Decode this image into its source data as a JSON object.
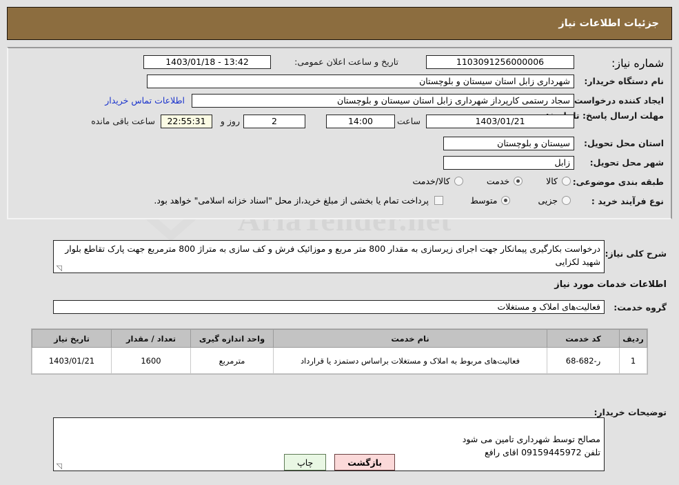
{
  "header": {
    "title": "جزئیات اطلاعات نیاز"
  },
  "form": {
    "need_number": {
      "label": "شماره نیاز:",
      "value": "1103091256000006"
    },
    "public_announce": {
      "label": "تاریخ و ساعت اعلان عمومی:",
      "value": "13:42 - 1403/01/18"
    },
    "buyer_org": {
      "label": "نام دستگاه خریدار:",
      "value": "شهرداری زابل استان سیستان و بلوچستان"
    },
    "buyer_org_cont": {
      "value": "شهرداری زابل استان سیستان و بلوچستان"
    },
    "requester": {
      "label": "ایجاد کننده درخواست:",
      "value": "سجاد رستمی کارپرداز شهرداری زابل استان سیستان و بلوچستان"
    },
    "contact_link": {
      "label": "اطلاعات تماس خریدار"
    },
    "deadline": {
      "label": "مهلت ارسال پاسخ: تا تاریخ:",
      "date": "1403/01/21",
      "time_label": "ساعت",
      "time": "14:00",
      "days": "2",
      "days_label": "روز و",
      "countdown": "22:55:31",
      "remaining_label": "ساعت باقی مانده"
    },
    "province": {
      "label": "استان محل تحویل:",
      "value": "سیستان و بلوچستان"
    },
    "city": {
      "label": "شهر محل تحویل:",
      "value": "زابل"
    },
    "category": {
      "label": "طبقه بندی موضوعی:",
      "options": [
        "کالا",
        "خدمت",
        "کالا/خدمت"
      ],
      "selected": "خدمت"
    },
    "process_type": {
      "label": "نوع فرآیند خرید :",
      "options": [
        "جزیی",
        "متوسط"
      ],
      "selected": "متوسط",
      "checkbox_label": "پرداخت تمام یا بخشی از مبلغ خرید،از محل \"اسناد خزانه اسلامی\" خواهد بود.",
      "checkbox_checked": false
    },
    "summary": {
      "label": "شرح کلی نیاز:",
      "value": "درخواست بکارگیری پیمانکار جهت اجرای زیرسازی به مقدار 800 متر مربع و موزائیک فرش و کف سازی به متراژ 800 مترمربع جهت پارک تقاطع بلوار شهید لکزایی"
    },
    "services_section_title": "اطلاعات خدمات مورد نیاز",
    "service_group": {
      "label": "گروه خدمت:",
      "value": "فعالیت‌های  املاک و مستغلات"
    },
    "notes": {
      "label": "توضیحات خریدار:",
      "value": "مصالح توسط شهرداری تامین می شود\nتلفن 09159445972 اقای رافع"
    }
  },
  "table": {
    "headers": [
      "ردیف",
      "کد خدمت",
      "نام خدمت",
      "واحد اندازه گیری",
      "تعداد / مقدار",
      "تاریخ نیاز"
    ],
    "rows": [
      {
        "row": "1",
        "code": "ر-682-68",
        "name": "فعالیت‌های مربوط به املاک و مستغلات براساس دستمزد یا قرارداد",
        "unit": "مترمربع",
        "qty": "1600",
        "date": "1403/01/21"
      }
    ]
  },
  "buttons": {
    "print": "چاپ",
    "back": "بازگشت"
  },
  "watermark": {
    "text": "AriaTender.net"
  },
  "colors": {
    "header_bg": "#8c6d3f",
    "link": "#1a33cc",
    "print_bg": "#e9f7e4",
    "back_bg": "#fbd9d9"
  }
}
